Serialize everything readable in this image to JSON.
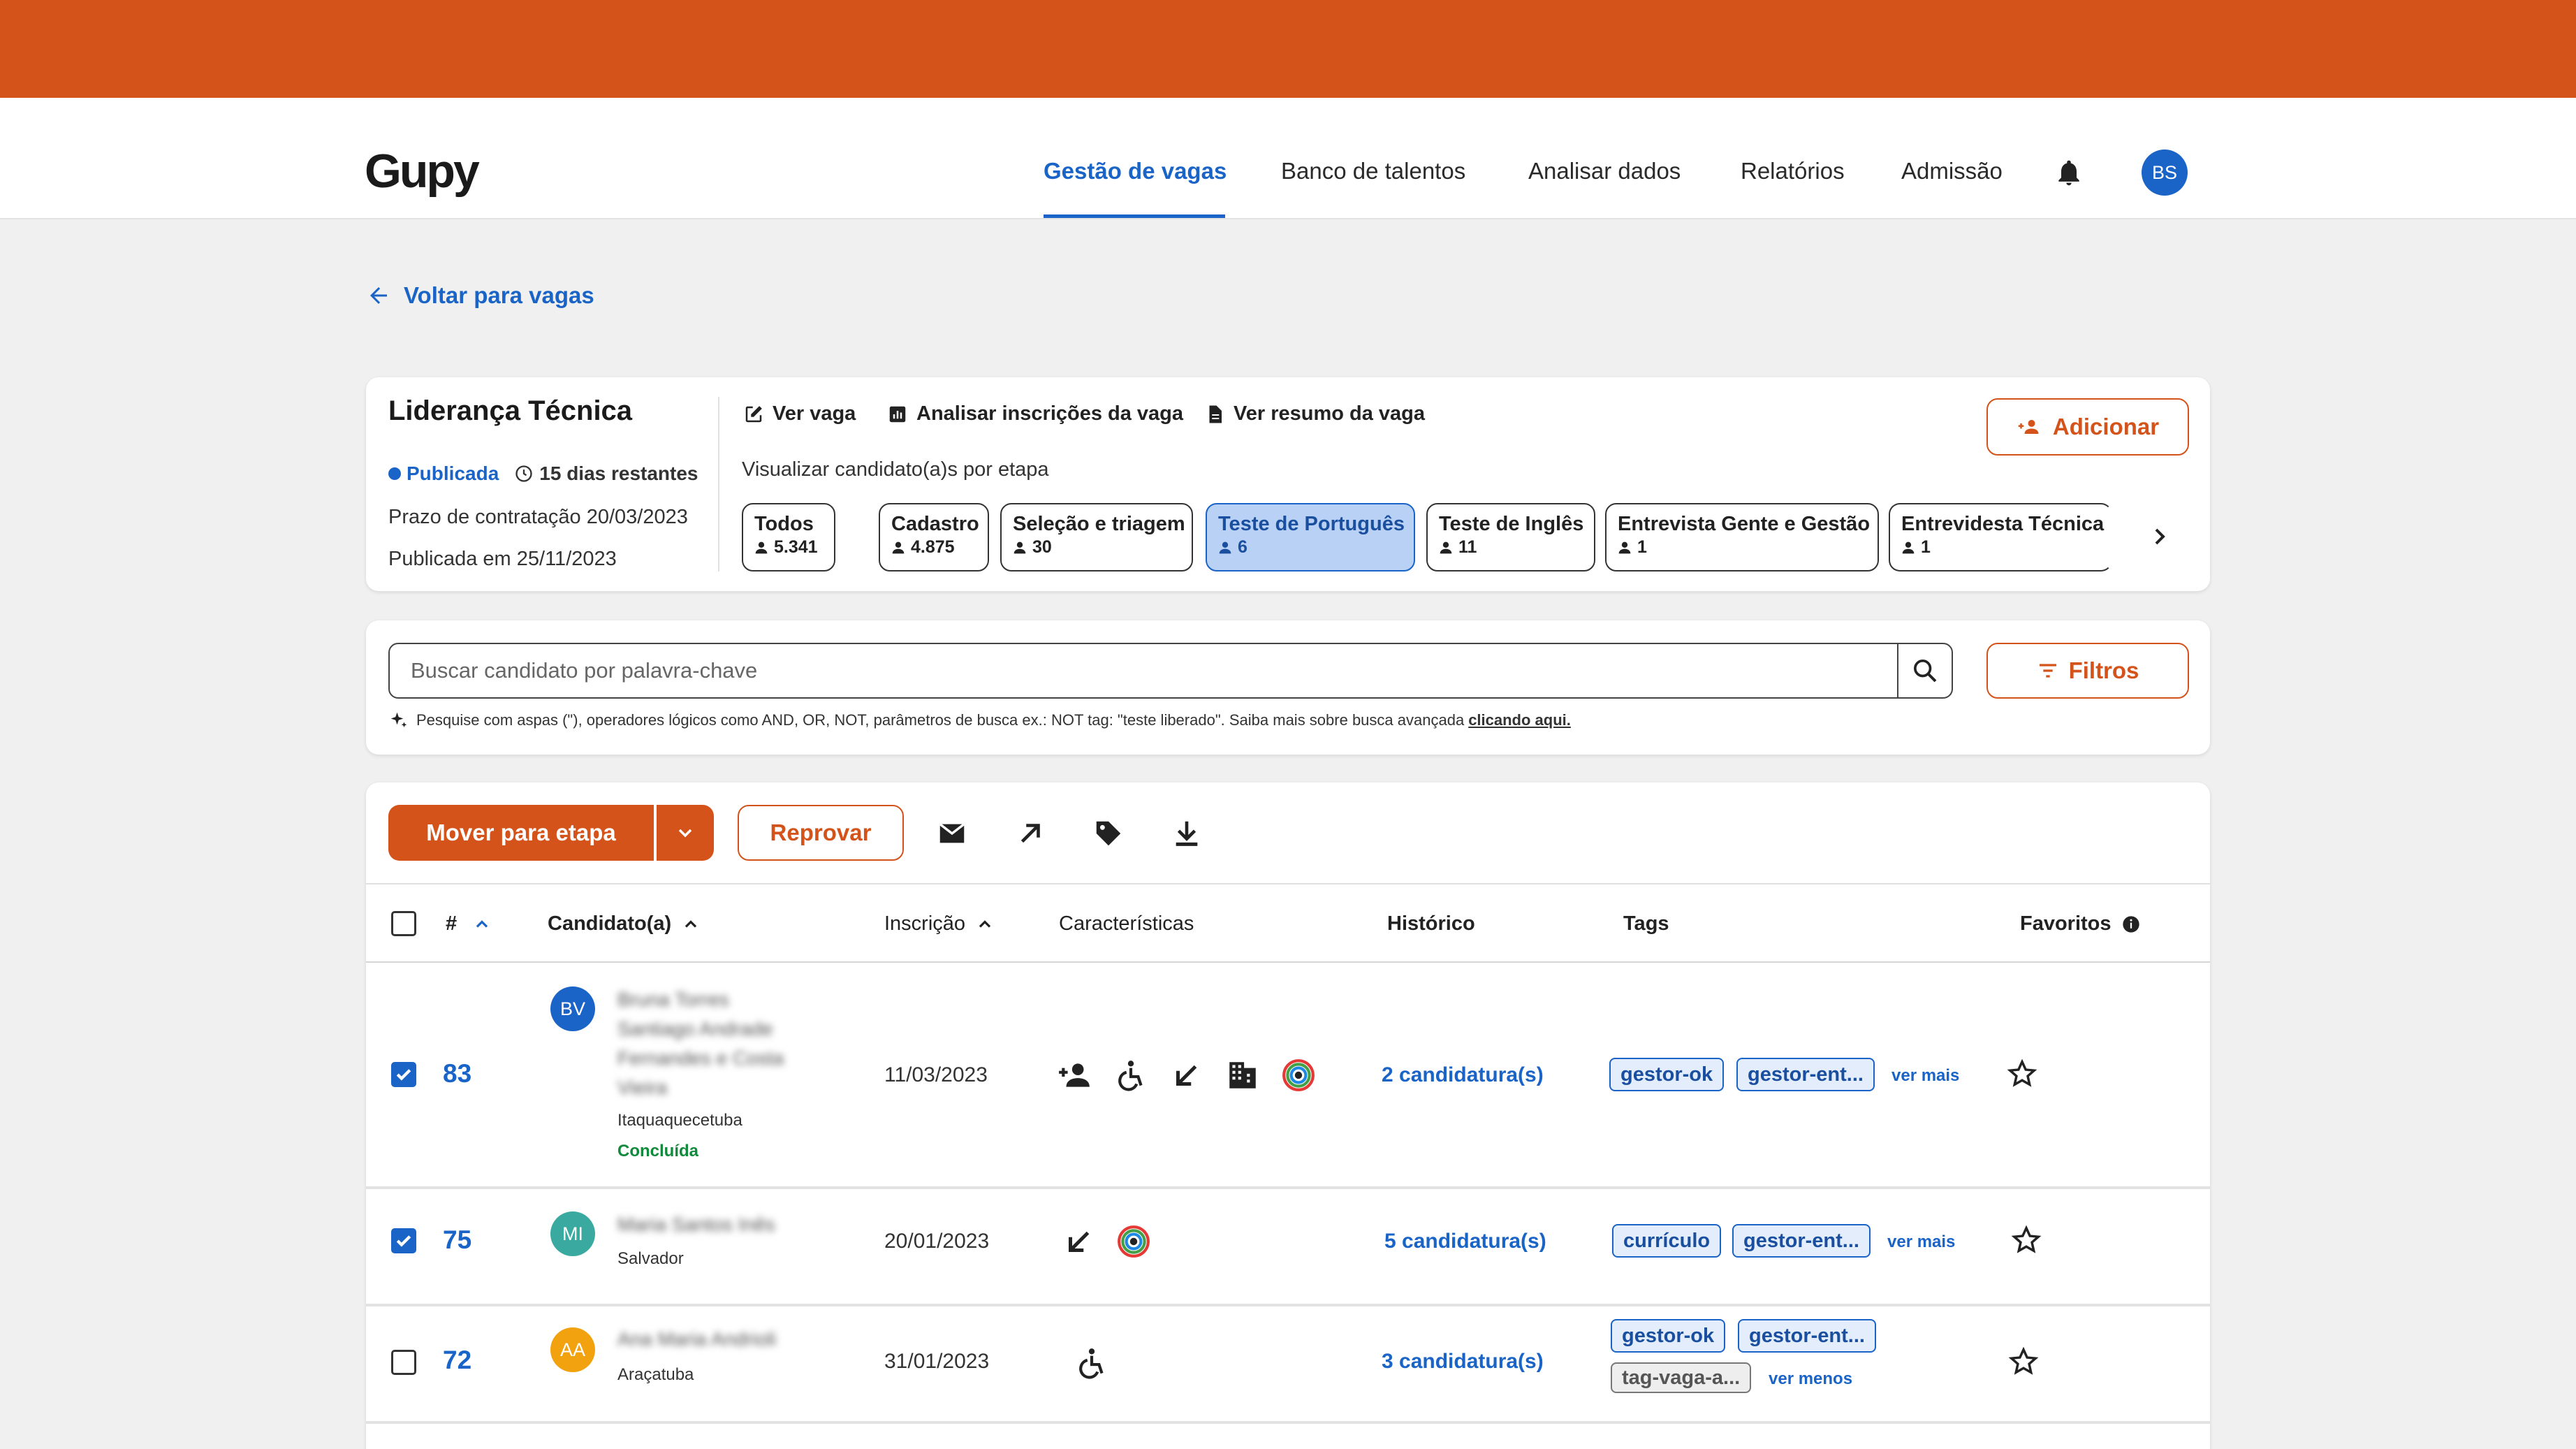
{
  "app": {
    "brand": "Gupy",
    "accent": "#d4531a",
    "link": "#1a64c8"
  },
  "nav": {
    "items": [
      {
        "label": "Gestão de vagas",
        "active": true
      },
      {
        "label": "Banco de talentos"
      },
      {
        "label": "Analisar dados"
      },
      {
        "label": "Relatórios"
      },
      {
        "label": "Admissão"
      }
    ],
    "bell_icon": "bell-icon",
    "avatar_initials": "BS"
  },
  "back_label": "Voltar para vagas",
  "job": {
    "title": "Liderança Técnica",
    "status": "Publicada",
    "days_left": "15 dias restantes",
    "deadline": "Prazo de contratação 20/03/2023",
    "published": "Publicada em 25/11/2023",
    "actions": [
      "Ver vaga",
      "Analisar inscrições da vaga",
      "Ver resumo da vaga"
    ],
    "add_label": "Adicionar",
    "stage_caption": "Visualizar candidato(a)s por etapa",
    "stages": [
      {
        "label": "Todos",
        "count": "5.341"
      },
      {
        "label": "Cadastro",
        "count": "4.875"
      },
      {
        "label": "Seleção e triagem",
        "count": "30"
      },
      {
        "label": "Teste de Português",
        "count": "6",
        "selected": true
      },
      {
        "label": "Teste de Inglês",
        "count": "11"
      },
      {
        "label": "Entrevista Gente e Gestão",
        "count": "1"
      },
      {
        "label": "Entrevidesta Técnica",
        "count": "1"
      }
    ]
  },
  "search": {
    "placeholder": "Buscar candidato por palavra-chave",
    "filters_label": "Filtros",
    "hint": "Pesquise com aspas (\"), operadores lógicos como AND, OR, NOT, parâmetros de busca ex.: NOT tag: \"teste liberado\". Saiba mais sobre busca avançada",
    "hint_link": "clicando aqui."
  },
  "toolbar": {
    "move_label": "Mover para etapa",
    "reject_label": "Reprovar"
  },
  "table": {
    "headers": {
      "num": "#",
      "candidate": "Candidato(a)",
      "date": "Inscrição",
      "features": "Características",
      "history": "Histórico",
      "tags": "Tags",
      "favorites": "Favoritos"
    },
    "rows": [
      {
        "checked": true,
        "num": "83",
        "initials": "BV",
        "avatar_color": "#1a64c8",
        "name_lines": [
          "Bruna Torres",
          "Santiago Andrade",
          "Fernandes e Costa",
          "Vieira"
        ],
        "city": "Itaquaquecetuba",
        "status": "Concluída",
        "date": "11/03/2023",
        "features": [
          "person-add-icon",
          "accessibility-icon",
          "arrow-down-left-icon",
          "building-icon",
          "diversity-icon"
        ],
        "history": "2 candidatura(s)",
        "tags": [
          "gestor-ok",
          "gestor-ent..."
        ],
        "more": "ver mais"
      },
      {
        "checked": true,
        "num": "75",
        "initials": "MI",
        "avatar_color": "#3aa99f",
        "name_lines": [
          "Maria Santos Inês"
        ],
        "city": "Salvador",
        "date": "20/01/2023",
        "features": [
          "arrow-down-left-icon",
          "diversity-icon"
        ],
        "history": "5 candidatura(s)",
        "tags": [
          "currículo",
          "gestor-ent..."
        ],
        "more": "ver mais"
      },
      {
        "checked": false,
        "num": "72",
        "initials": "AA",
        "avatar_color": "#f2a10f",
        "name_lines": [
          "Ana Maria Andrioli"
        ],
        "city": "Araçatuba",
        "date": "31/01/2023",
        "features": [
          "accessibility-icon"
        ],
        "history": "3 candidatura(s)",
        "tags": [
          "gestor-ok",
          "gestor-ent...",
          "tag-vaga-a..."
        ],
        "more": "ver menos"
      }
    ]
  }
}
